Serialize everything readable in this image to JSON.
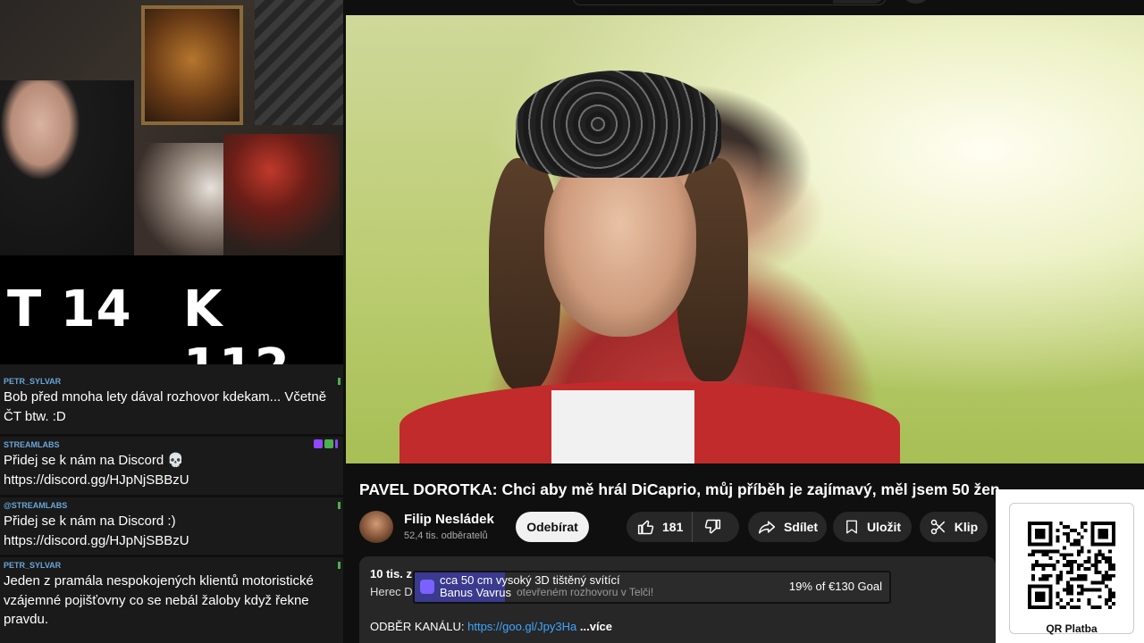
{
  "score": {
    "left": "T 14",
    "right": "K 112"
  },
  "chat": [
    {
      "user": "PETR_SYLVAR",
      "text": "Bob před mnoha lety dával rozhovor kdekam... Včetně ČT btw. :D"
    },
    {
      "user": "STREAMLABS",
      "text": "Přidej se k nám na Discord 💀 https://discord.gg/HJpNjSBBzU"
    },
    {
      "user": "@STREAMLABS",
      "text": "Přidej se k nám na Discord :) https://discord.gg/HJpNjSBBzU"
    },
    {
      "user": "PETR_SYLVAR",
      "text": "Jeden z pramála nespokojených klientů motoristické vzájemné pojišťovny co se nebál žaloby když řekne pravdu."
    }
  ],
  "video": {
    "title": "PAVEL DOROTKA: Chci aby mě hrál DiCaprio, můj příběh je zajímavý, měl jsem 50 žen",
    "channel": "Filip Nesládek",
    "subscribers": "52,4 tis. odběratelů",
    "subscribe_label": "Odebírat",
    "likes": "181",
    "share_label": "Sdílet",
    "save_label": "Uložit",
    "clip_label": "Klip"
  },
  "description": {
    "meta": "10 tis. z",
    "line2_start": "Herec D",
    "line2_end": "otevřeném rozhovoru v Telči!",
    "channel_sub_label": "ODBĚR KANÁLU:",
    "link": "https://goo.gl/Jpy3Ha",
    "more": "...více"
  },
  "goal": {
    "title": "cca 50 cm vysoký 3D tištěný svítící",
    "subtitle": "Banus Vavrus",
    "progress_text": "19% of €130 Goal",
    "progress": 0.19
  },
  "qr": {
    "label": "QR Platba"
  }
}
